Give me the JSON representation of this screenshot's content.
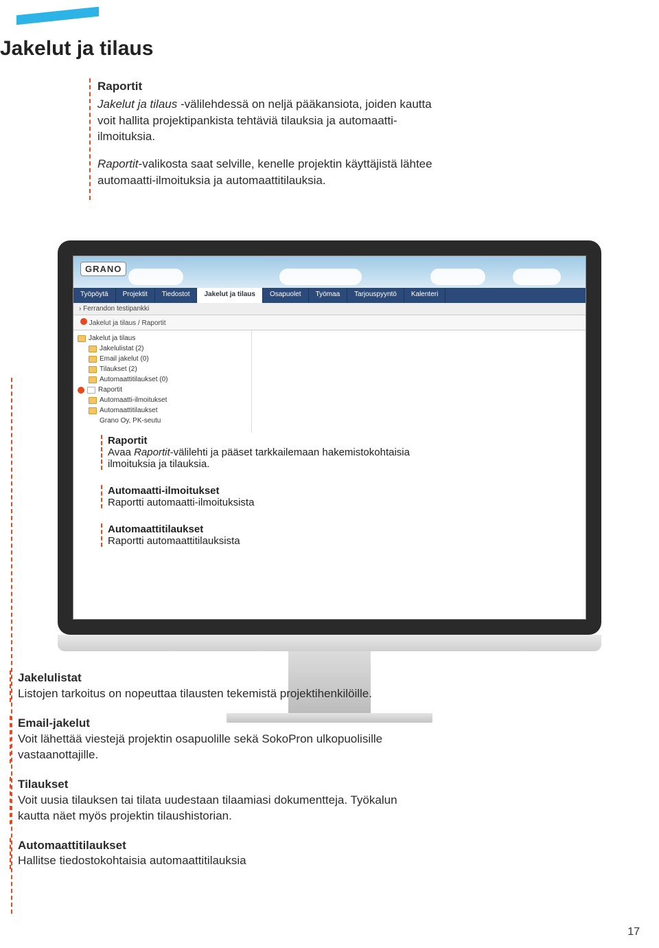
{
  "page": {
    "title": "Jakelut ja tilaus",
    "number": "17"
  },
  "intro": {
    "heading": "Raportit",
    "p1_a": "Jakelut ja tilaus",
    "p1_b": " -välilehdessä on neljä pääkansiota, joiden kautta voit hallita projektipankista tehtäviä tilauksia ja automaatti-ilmoituksia.",
    "p2_a": "Raportit",
    "p2_b": "-valikosta saat selville, kenelle projektin käyttäjistä lähtee automaatti-ilmoituksia ja automaattitilauksia."
  },
  "app": {
    "logo": "GRANO",
    "tabs": [
      "Työpöytä",
      "Projektit",
      "Tiedostot",
      "Jakelut ja tilaus",
      "Osapuolet",
      "Työmaa",
      "Tarjouspyyntö",
      "Kalenteri"
    ],
    "breadcrumb": "› Ferrandon testipankki",
    "path": "Jakelut ja tilaus / Raportit",
    "tree": {
      "root": "Jakelut ja tilaus",
      "items": [
        "Jakelulistat (2)",
        "Email jakelut (0)",
        "Tilaukset (2)",
        "Automaattitilaukset (0)"
      ],
      "raportit": "Raportit",
      "rap_items": [
        "Automaatti-ilmoitukset",
        "Automaattitilaukset"
      ],
      "footer": "Grano Oy, PK-seutu"
    }
  },
  "overlay": {
    "b1": {
      "h": "Raportit",
      "t1": "Avaa ",
      "em": "Raportit",
      "t2": "-välilehti ja pääset tarkkailemaan hakemistokohtaisia ilmoituksia ja tilauksia."
    },
    "b2": {
      "h": "Automaatti-ilmoitukset",
      "t": "Raportti automaatti-ilmoituksista"
    },
    "b3": {
      "h": "Automaattitilaukset",
      "t": "Raportti automaattitilauksista"
    }
  },
  "bottom": {
    "s1": {
      "h": "Jakelulistat",
      "t": "Listojen tarkoitus on nopeuttaa tilausten tekemistä projektihenkilöille."
    },
    "s2": {
      "h": "Email-jakelut",
      "t": "Voit lähettää viestejä projektin osapuolille sekä SokoPron ulkopuolisille vastaanottajille."
    },
    "s3": {
      "h": "Tilaukset",
      "t": "Voit uusia tilauksen tai tilata uudestaan tilaamiasi dokumentteja. Työkalun kautta näet myös projektin tilaushistorian."
    },
    "s4": {
      "h": "Automaattitilaukset",
      "t": "Hallitse tiedostokohtaisia automaattitilauksia"
    }
  }
}
